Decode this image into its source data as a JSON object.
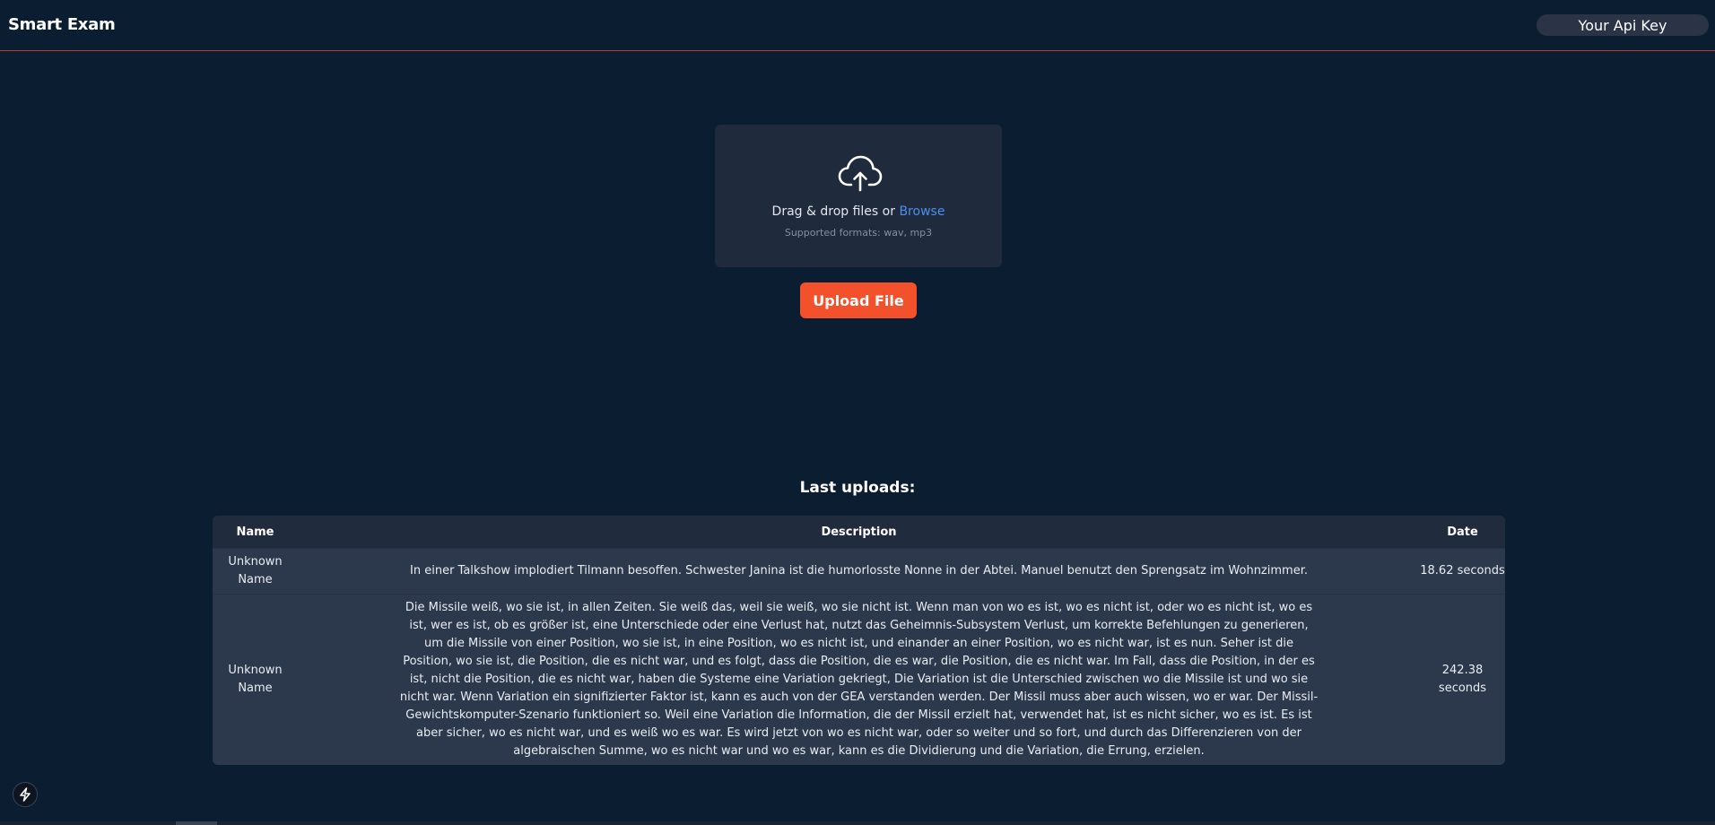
{
  "header": {
    "title": "Smart Exam",
    "api_key_placeholder": "Your Api Key"
  },
  "dropzone": {
    "icon": "cloud-upload-icon",
    "text": "Drag & drop files or ",
    "browse_label": "Browse",
    "formats": "Supported formats: wav, mp3"
  },
  "upload_button": "Upload File",
  "uploads": {
    "title": "Last uploads:",
    "columns": [
      "Name",
      "Description",
      "Date"
    ],
    "rows": [
      {
        "name": "Unknown Name",
        "description": "In einer Talkshow implodiert Tilmann besoffen. Schwester Janina ist die humorlosste Nonne in der Abtei. Manuel benutzt den Sprengsatz im Wohnzimmer.",
        "date": "18.62 seconds"
      },
      {
        "name": "Unknown Name",
        "description": "Die Missile weiß, wo sie ist, in allen Zeiten. Sie weiß das, weil sie weiß, wo sie nicht ist. Wenn man von wo es ist, wo es nicht ist, oder wo es nicht ist, wo es ist, wer es ist, ob es größer ist, eine Unterschiede oder eine Verlust hat, nutzt das Geheimnis-Subsystem Verlust, um korrekte Befehlungen zu generieren, um die Missile von einer Position, wo sie ist, in eine Position, wo es nicht ist, und einander an einer Position, wo es nicht war, ist es nun. Seher ist die Position, wo sie ist, die Position, die es nicht war, und es folgt, dass die Position, die es war, die Position, die es nicht war. Im Fall, dass die Position, in der es ist, nicht die Position, die es nicht war, haben die Systeme eine Variation gekriegt, Die Variation ist die Unterschied zwischen wo die Missile ist und wo sie nicht war. Wenn Variation ein signifizierter Faktor ist, kann es auch von der GEA verstanden werden. Der Missil muss aber auch wissen, wo er war. Der Missil-Gewichtskomputer-Szenario funktioniert so. Weil eine Variation die Information, die der Missil erzielt hat, verwendet hat, ist es nicht sicher, wo es ist. Es ist aber sicher, wo es nicht war, und es weiß wo es war. Es wird jetzt von wo es nicht war, oder so weiter und so fort, und durch das Differenzieren von der algebraischen Summe, wo es nicht war und wo es war, kann es die Dividierung und die Variation, die Errung, erzielen.",
        "date": "242.38 seconds"
      }
    ]
  },
  "devtools_icon": "lightning-icon",
  "colors": {
    "background": "#0a1d31",
    "accent": "#f2512b",
    "link": "#4b8fe9",
    "header_border": "#c0393b"
  }
}
